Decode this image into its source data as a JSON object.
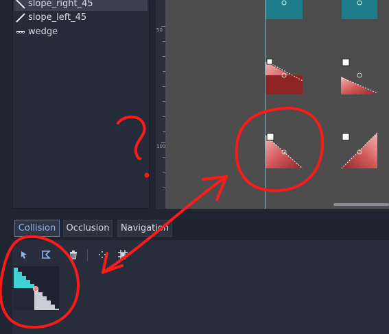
{
  "tile_list": {
    "items": [
      {
        "label": "slope_right_45"
      },
      {
        "label": "slope_left_45"
      },
      {
        "label": "wedge"
      }
    ]
  },
  "ruler": {
    "labels": [
      "50",
      "100"
    ]
  },
  "tabs": [
    {
      "label": "Collision"
    },
    {
      "label": "Occlusion"
    },
    {
      "label": "Navigation"
    }
  ],
  "toolbar": {
    "icons": [
      "select-pointer-icon",
      "edit-polygon-icon",
      "delete-icon",
      "grid-snap-icon",
      "keep-inside-icon"
    ]
  },
  "annotation": {
    "question_mark": "?",
    "color": "#ff1a1a"
  },
  "colors": {
    "accent": "#8fb6f0",
    "tile_red": "#b83a3a",
    "tile_teal": "#1a7f8e",
    "viewport_bg": "#4d4d4d"
  }
}
